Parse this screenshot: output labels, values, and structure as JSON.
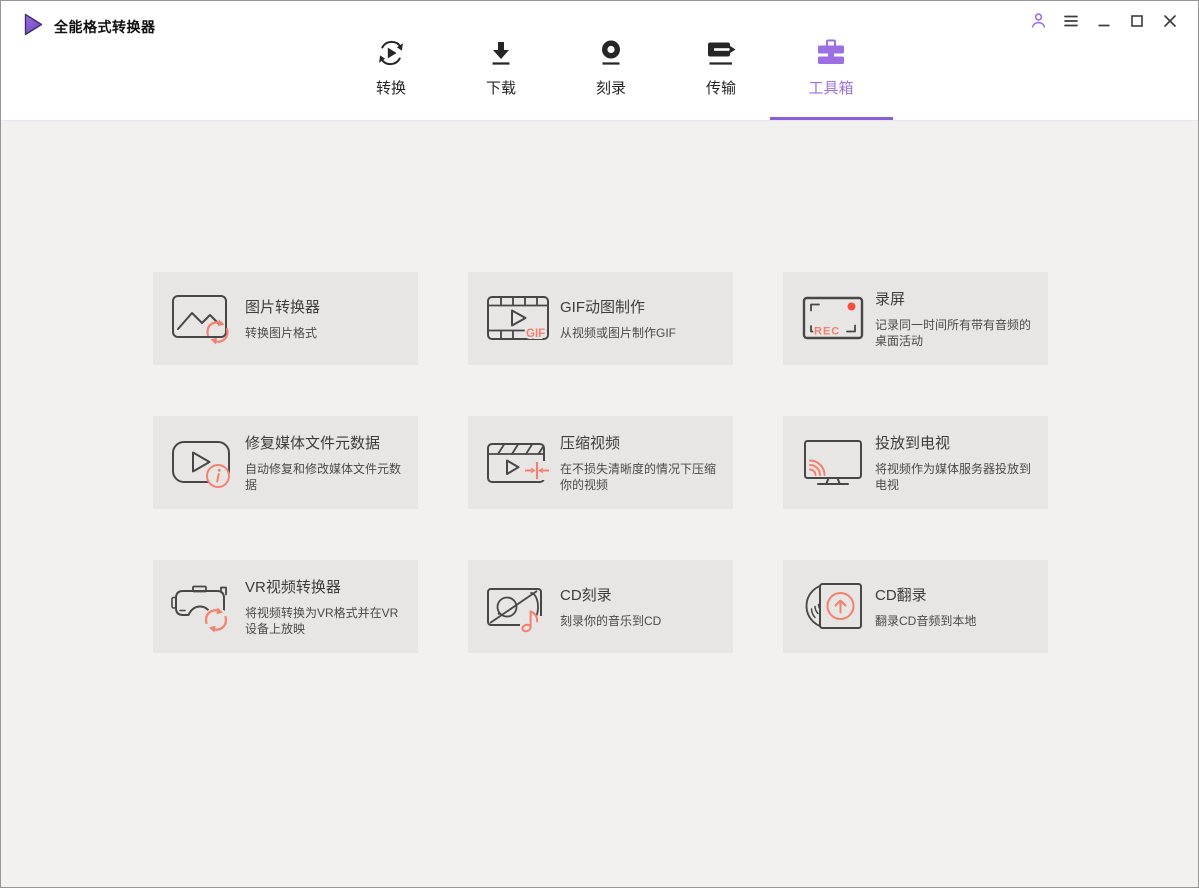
{
  "app": {
    "title": "全能格式转换器",
    "logo_icon": "play-triangle-logo-icon"
  },
  "window_controls": [
    {
      "name": "account-button",
      "icon": "user-icon"
    },
    {
      "name": "menu-button",
      "icon": "menu-icon"
    },
    {
      "name": "minimize-button",
      "icon": "minimize-icon"
    },
    {
      "name": "maximize-button",
      "icon": "maximize-icon"
    },
    {
      "name": "close-button",
      "icon": "close-icon"
    }
  ],
  "tabs": [
    {
      "label": "转换",
      "icon": "convert-icon",
      "active": false
    },
    {
      "label": "下载",
      "icon": "download-icon",
      "active": false
    },
    {
      "label": "刻录",
      "icon": "burn-icon",
      "active": false
    },
    {
      "label": "传输",
      "icon": "transfer-icon",
      "active": false
    },
    {
      "label": "工具箱",
      "icon": "toolbox-icon",
      "active": true
    }
  ],
  "cards": [
    {
      "title": "图片转换器",
      "subtitle": "转换图片格式",
      "icon": "image-converter-icon"
    },
    {
      "title": "GIF动图制作",
      "subtitle": "从视频或图片制作GIF",
      "icon": "gif-maker-icon",
      "icon_text": "GIF"
    },
    {
      "title": "录屏",
      "subtitle": "记录同一时间所有带有音频的桌面活动",
      "icon": "screen-recorder-icon",
      "icon_text": "REC"
    },
    {
      "title": "修复媒体文件元数据",
      "subtitle": "自动修复和修改媒体文件元数据",
      "icon": "fix-metadata-icon"
    },
    {
      "title": "压缩视频",
      "subtitle": "在不损失清晰度的情况下压缩你的视频",
      "icon": "compress-video-icon"
    },
    {
      "title": "投放到电视",
      "subtitle": "将视频作为媒体服务器投放到电视",
      "icon": "cast-to-tv-icon"
    },
    {
      "title": "VR视频转换器",
      "subtitle": "将视频转换为VR格式并在VR设备上放映",
      "icon": "vr-converter-icon"
    },
    {
      "title": "CD刻录",
      "subtitle": "刻录你的音乐到CD",
      "icon": "cd-burner-icon"
    },
    {
      "title": "CD翻录",
      "subtitle": "翻录CD音频到本地",
      "icon": "cd-ripper-icon"
    }
  ],
  "colors": {
    "accent": "#9c70e2",
    "accent_dark": "#8c5ed8",
    "coral": "#f4816f",
    "record_red": "#f4513d",
    "card_bg": "#e7e6e4",
    "page_bg": "#f2f1ef",
    "header_bg": "#ffffff",
    "icon_ink": "#474747",
    "nav_ink": "#262626"
  }
}
